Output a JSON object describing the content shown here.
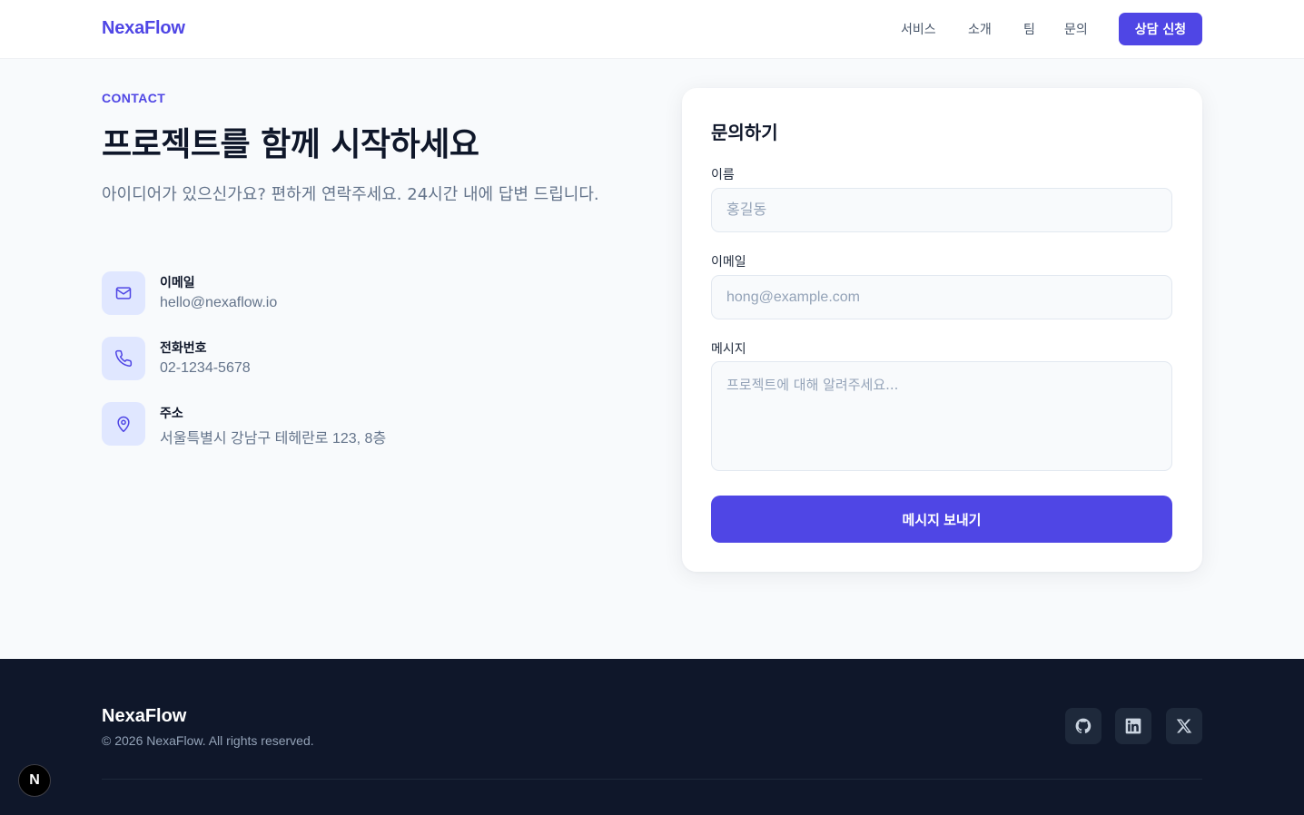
{
  "header": {
    "logo": "NexaFlow",
    "nav": [
      "서비스",
      "소개",
      "팀",
      "문의"
    ],
    "cta": "상담 신청"
  },
  "contact": {
    "eyebrow": "CONTACT",
    "headline": "프로젝트를 함께 시작하세요",
    "subtitle": "아이디어가 있으신가요? 편하게 연락주세요. 24시간 내에 답변 드립니다.",
    "items": [
      {
        "label": "이메일",
        "value": "hello@nexaflow.io",
        "icon": "mail-icon"
      },
      {
        "label": "전화번호",
        "value": "02-1234-5678",
        "icon": "phone-icon"
      },
      {
        "label": "주소",
        "value": "서울특별시 강남구 테헤란로 123, 8층",
        "icon": "map-pin-icon"
      }
    ]
  },
  "form": {
    "title": "문의하기",
    "name_label": "이름",
    "name_placeholder": "홍길동",
    "email_label": "이메일",
    "email_placeholder": "hong@example.com",
    "message_label": "메시지",
    "message_placeholder": "프로젝트에 대해 알려주세요...",
    "submit": "메시지 보내기"
  },
  "footer": {
    "brand": "NexaFlow",
    "copyright": "© 2026 NexaFlow. All rights reserved.",
    "social": [
      "github-icon",
      "linkedin-icon",
      "x-icon"
    ]
  },
  "dev_badge": "N",
  "colors": {
    "accent": "#4f46e5",
    "accent_soft": "#e0e7ff",
    "footer_bg": "#0f172a",
    "page_bg": "#f8fafc"
  }
}
